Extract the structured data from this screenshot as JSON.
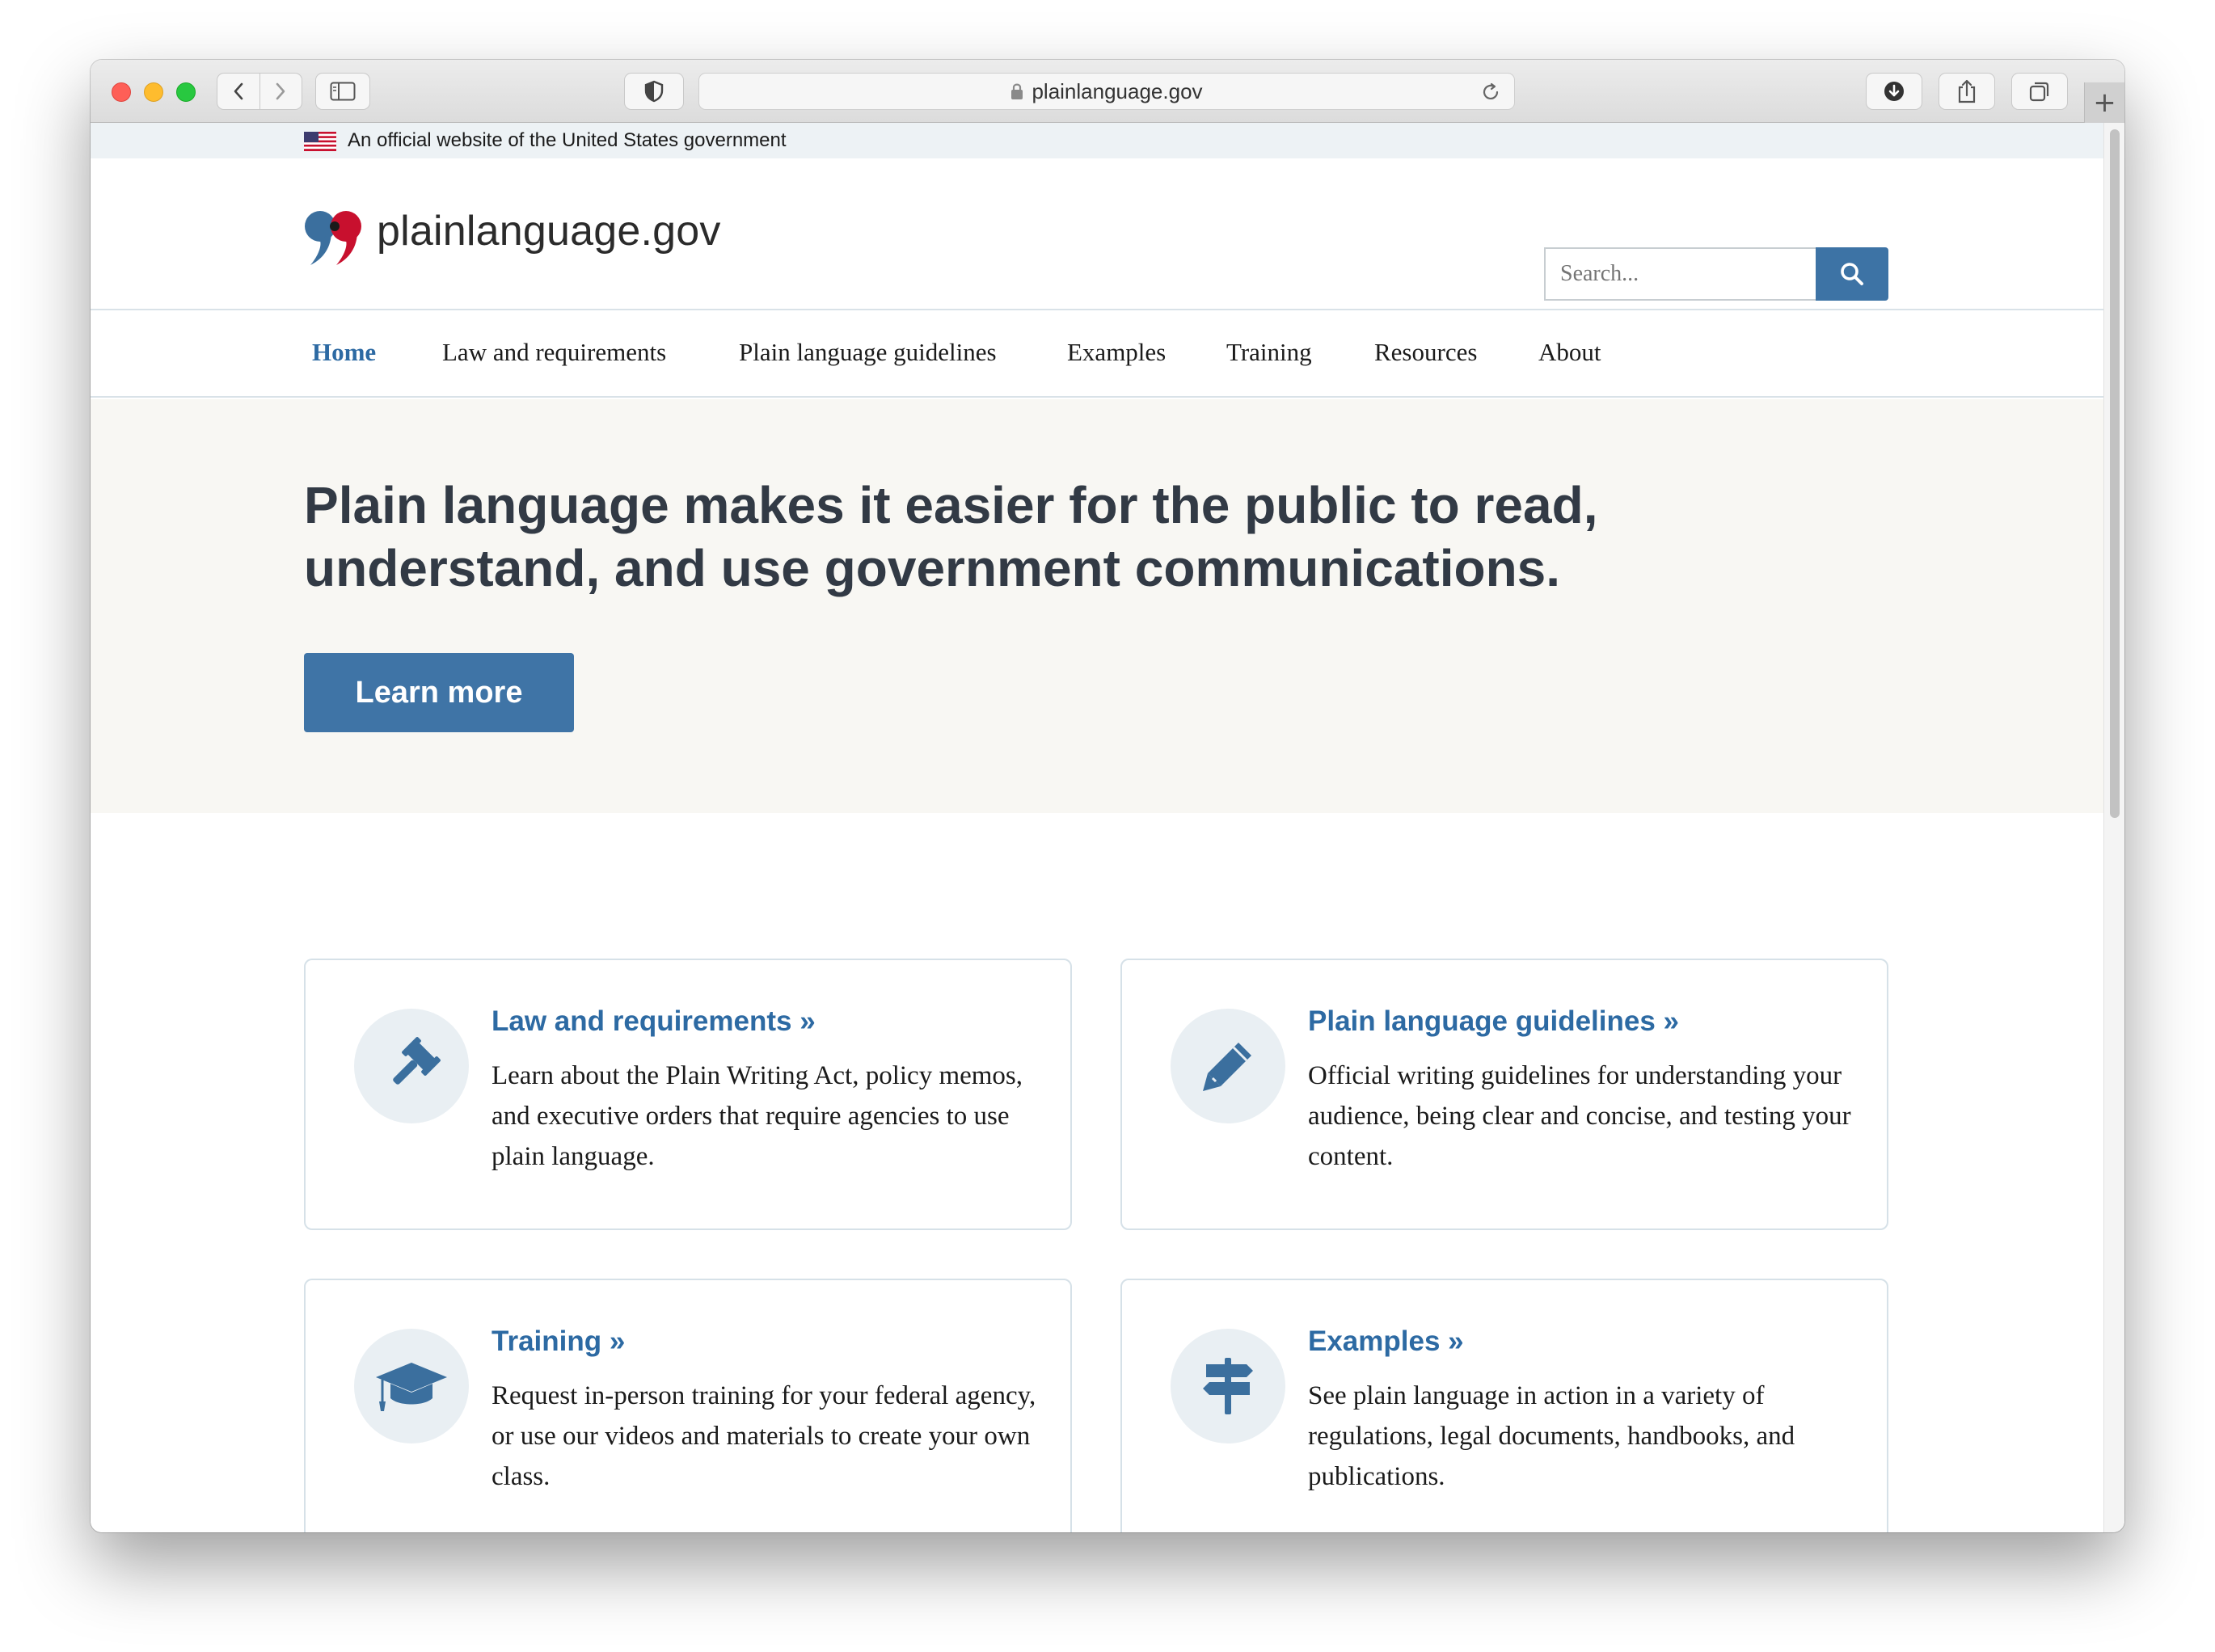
{
  "browser": {
    "url": "plainlanguage.gov",
    "new_tab_label": "+"
  },
  "gov_banner": {
    "text": "An official website of the United States government"
  },
  "header": {
    "site_name": "plainlanguage.gov",
    "search_placeholder": "Search..."
  },
  "nav": {
    "items": [
      {
        "label": "Home",
        "active": true
      },
      {
        "label": "Law and requirements",
        "active": false
      },
      {
        "label": "Plain language guidelines",
        "active": false
      },
      {
        "label": "Examples",
        "active": false
      },
      {
        "label": "Training",
        "active": false
      },
      {
        "label": "Resources",
        "active": false
      },
      {
        "label": "About",
        "active": false
      }
    ]
  },
  "hero": {
    "headline": "Plain language makes it easier for the public to read, understand, and use government communications.",
    "button_label": "Learn more"
  },
  "cards": [
    {
      "icon": "gavel-icon",
      "title": "Law and requirements »",
      "description": "Learn about the Plain Writing Act, policy memos, and executive orders that require agencies to use plain language."
    },
    {
      "icon": "pencil-icon",
      "title": "Plain language guidelines »",
      "description": "Official writing guidelines for understanding your audience, being clear and concise, and testing your content."
    },
    {
      "icon": "graduation-cap-icon",
      "title": "Training »",
      "description": "Request in-person training for your federal agency, or use our videos and materials to create your own class."
    },
    {
      "icon": "signpost-icon",
      "title": "Examples »",
      "description": "See plain language in action in a variety of regulations, legal documents, handbooks, and publications."
    }
  ],
  "colors": {
    "primary": "#3d73a5",
    "link": "#2d6aa3",
    "hero_background": "#f8f7f3",
    "banner_background": "#edf2f5",
    "heading_text": "#323a45",
    "logo_blue": "#3b6f9e",
    "logo_red": "#c8102e"
  }
}
